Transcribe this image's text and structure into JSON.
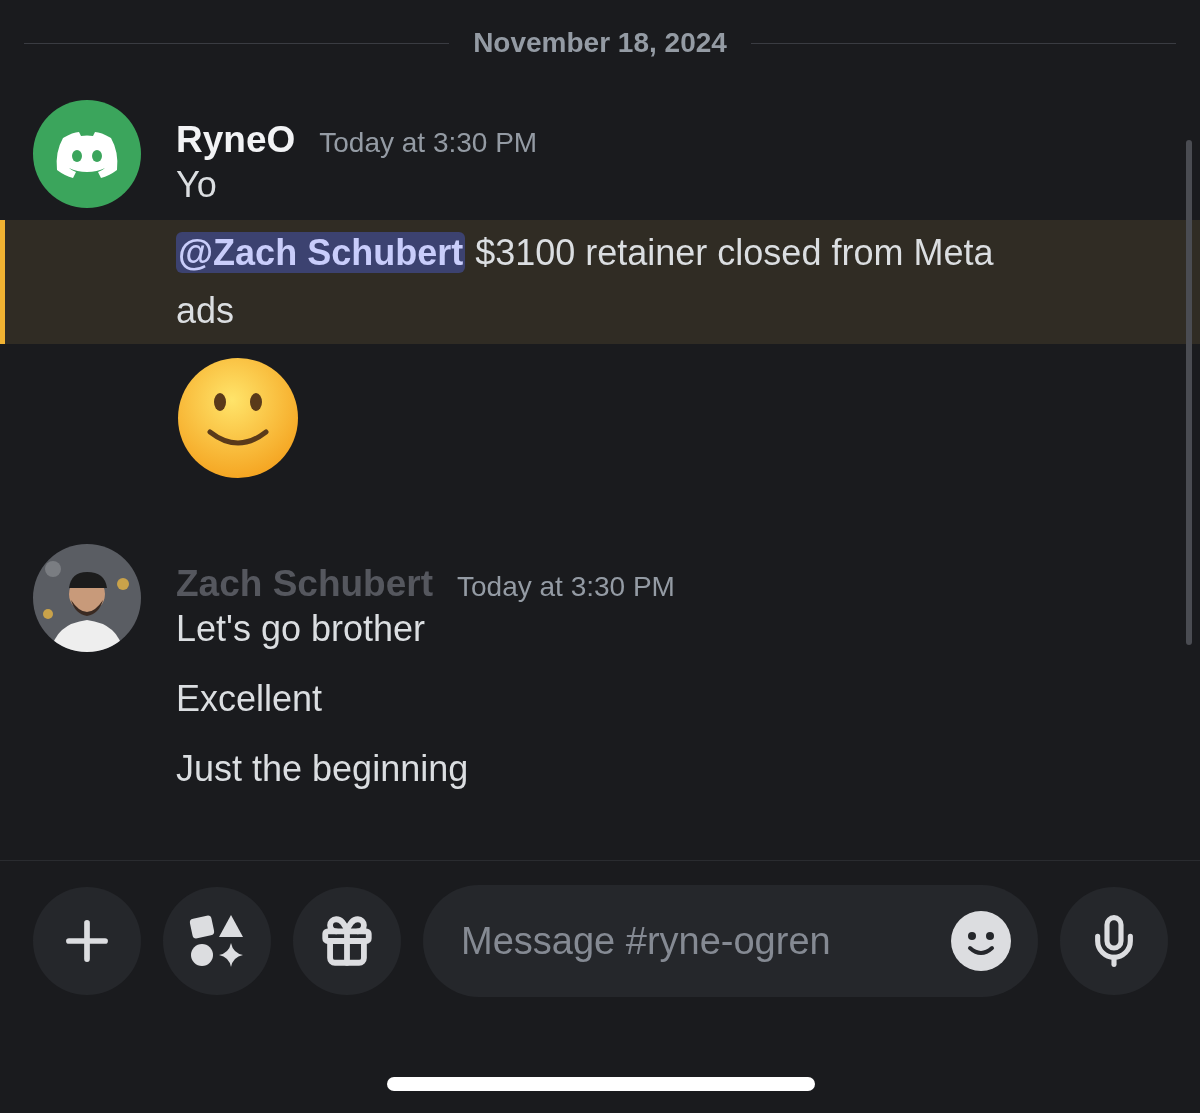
{
  "date_divider": "November 18, 2024",
  "message_groups": [
    {
      "author": "RyneO",
      "color": "#f2f3f5",
      "timestamp": "Today at 3:30 PM",
      "avatar": {
        "kind": "logo"
      },
      "messages": [
        {
          "kind": "text",
          "text": "Yo",
          "highlighted": false
        },
        {
          "kind": "mention",
          "mention": "@Zach Schubert",
          "text": "$3100 retainer closed from Meta ads",
          "highlighted": true
        },
        {
          "kind": "emoji",
          "highlighted": false
        }
      ]
    },
    {
      "author": "Zach Schubert",
      "color": "#55575e",
      "timestamp": "Today at 3:30 PM",
      "messages": [
        {
          "kind": "text",
          "text": "Let's go brother",
          "highlighted": false
        },
        {
          "kind": "text",
          "text": "Excellent",
          "highlighted": false
        },
        {
          "kind": "text",
          "text": "Just the beginning",
          "highlighted": false
        }
      ]
    }
  ],
  "composer": {
    "placeholder": "Message #ryne-ogren"
  }
}
